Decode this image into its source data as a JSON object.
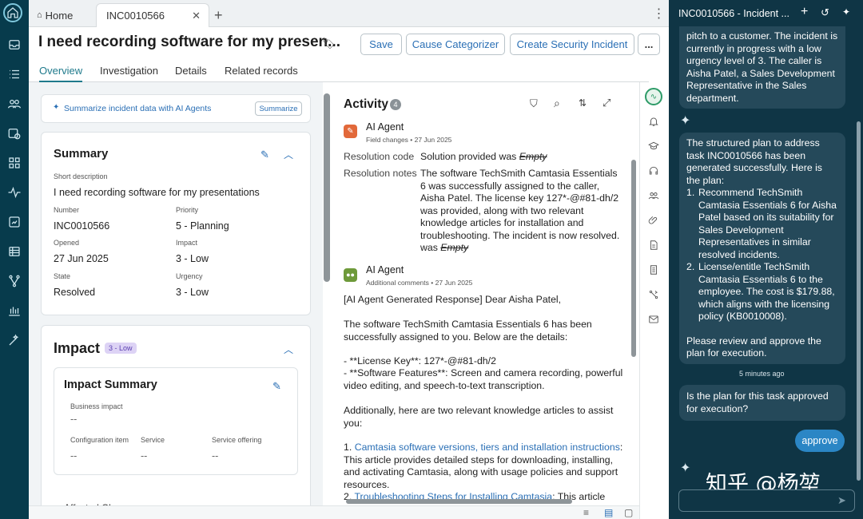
{
  "tabs": {
    "home": "Home",
    "record": "INC0010566"
  },
  "record": {
    "title": "I need recording software for my presen...",
    "save": "Save",
    "cause": "Cause Categorizer",
    "security": "Create Security Incident",
    "more": "..."
  },
  "subtabs": [
    "Overview",
    "Investigation",
    "Details",
    "Related records"
  ],
  "ai_banner": {
    "text": "Summarize incident data with AI Agents",
    "button": "Summarize"
  },
  "summary": {
    "heading": "Summary",
    "short_desc_label": "Short description",
    "short_desc": "I need recording software for my presentations",
    "number_label": "Number",
    "number": "INC0010566",
    "priority_label": "Priority",
    "priority": "5 - Planning",
    "opened_label": "Opened",
    "opened": "27 Jun 2025",
    "impact_label": "Impact",
    "impact": "3 - Low",
    "state_label": "State",
    "state": "Resolved",
    "urgency_label": "Urgency",
    "urgency": "3 - Low"
  },
  "impact": {
    "heading": "Impact",
    "badge": "3 - Low",
    "sub": "Impact Summary",
    "business_label": "Business impact",
    "business": "--",
    "ci_label": "Configuration item",
    "ci": "--",
    "service_label": "Service",
    "service": "--",
    "offering_label": "Service offering",
    "offering": "--",
    "affected": "Affected CIs"
  },
  "activity": {
    "heading": "Activity",
    "count": "4",
    "e1": {
      "author": "AI Agent",
      "meta": "Field changes • 27 Jun 2025",
      "rc_label": "Resolution code",
      "rc_val": "Solution provided was",
      "rc_old": "Empty",
      "rn_label": "Resolution notes",
      "rn_val": "The software TechSmith Camtasia Essentials 6 was successfully assigned to the caller, Aisha Patel. The license key 127*-@#81-dh/2 was provided, along with two relevant knowledge articles for installation and troubleshooting. The incident is now resolved.",
      "rn_was": "was",
      "rn_old": "Empty"
    },
    "e2": {
      "author": "AI Agent",
      "meta": "Additional comments • 27 Jun 2025",
      "p1": "[AI Agent Generated Response] Dear Aisha Patel,",
      "p2": "The software TechSmith Camtasia Essentials 6 has been successfully assigned to you. Below are the details:",
      "p3a": "- **License Key**: 127*-@#81-dh/2",
      "p3b": "- **Software Features**: Screen and camera recording, powerful video editing, and speech-to-text transcription.",
      "p4": "Additionally, here are two relevant knowledge articles to assist you:",
      "l1_num": "1.",
      "l1_link": "Camtasia software versions, tiers and installation instructions",
      "l1_text": ": This article provides detailed steps for downloading, installing, and activating Camtasia, along with usage policies and support resources.",
      "l2_num": "2.",
      "l2_link": "Troubleshooting Steps for Installing Camtasia",
      "l2_text": ": This article"
    }
  },
  "chat": {
    "title": "INC0010566 - Incident ...",
    "m1": "pitch to a customer. The incident is currently in progress with a low urgency level of 3. The caller is Aisha Patel, a Sales Development Representative in the Sales department.",
    "m2_intro": "The structured plan to address task INC0010566 has been generated successfully. Here is the plan:",
    "m2_i1": "Recommend TechSmith Camtasia Essentials 6 for Aisha Patel based on its suitability for Sales Development Representatives in similar resolved incidents.",
    "m2_i2": "License/entitle TechSmith Camtasia Essentials 6 to the employee. The cost is $179.88, which aligns with the licensing policy (KB0010008).",
    "m2_outro": "Please review and approve the plan for execution.",
    "time": "5 minutes ago",
    "m3": "Is the plan for this task approved for execution?",
    "reply": "approve",
    "watermark": "知乎 @杨堃"
  }
}
